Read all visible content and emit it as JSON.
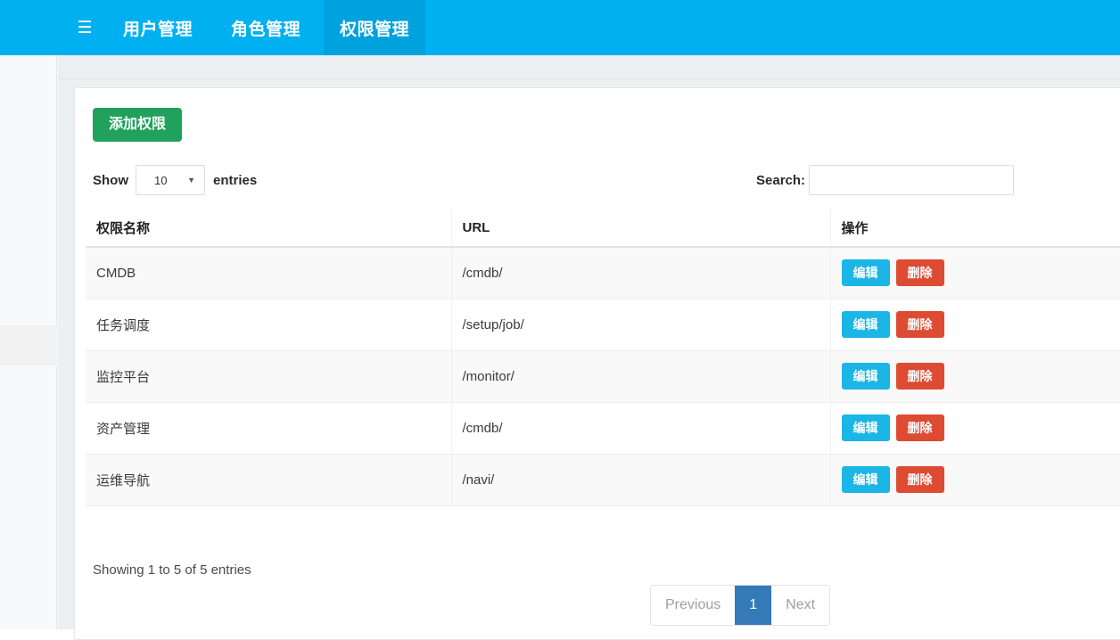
{
  "navbar": {
    "menu_icon": "hamburger-icon",
    "items": [
      {
        "label": "用户管理",
        "active": false
      },
      {
        "label": "角色管理",
        "active": false
      },
      {
        "label": "权限管理",
        "active": true
      }
    ],
    "bg_color": "#00b0f0",
    "active_bg_color": "#00a2dd"
  },
  "toolbar": {
    "add_label": "添加权限",
    "add_color": "#20a15c"
  },
  "datatable": {
    "length": {
      "show_label": "Show",
      "selected": "10",
      "entries_label": "entries",
      "caret_icon": "chevron-down-icon"
    },
    "search": {
      "label": "Search:",
      "value": "",
      "placeholder": ""
    },
    "columns": [
      "权限名称",
      "URL",
      "操作"
    ],
    "rows": [
      {
        "name": "CMDB",
        "url": "/cmdb/",
        "edit": "编辑",
        "delete": "删除"
      },
      {
        "name": "任务调度",
        "url": "/setup/job/",
        "edit": "编辑",
        "delete": "删除"
      },
      {
        "name": "监控平台",
        "url": "/monitor/",
        "edit": "编辑",
        "delete": "删除"
      },
      {
        "name": "资产管理",
        "url": "/cmdb/",
        "edit": "编辑",
        "delete": "删除"
      },
      {
        "name": "运维导航",
        "url": "/navi/",
        "edit": "编辑",
        "delete": "删除"
      }
    ],
    "info": "Showing 1 to 5 of 5 entries",
    "pagination": {
      "previous": "Previous",
      "pages": [
        "1"
      ],
      "next": "Next",
      "current": "1",
      "active_color": "#337ab7"
    },
    "edit_color": "#1bb5e6",
    "delete_color": "#dd4b33"
  }
}
